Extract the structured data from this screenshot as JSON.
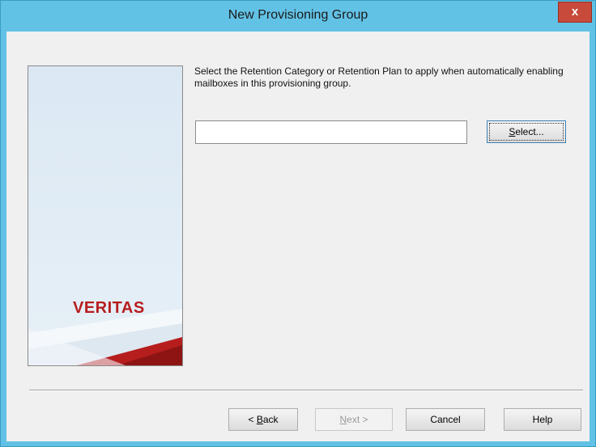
{
  "window": {
    "title": "New Provisioning Group",
    "close_label": "x"
  },
  "side_panel": {
    "logo_text": "VERITAS"
  },
  "content": {
    "instruction": "Select the Retention Category or Retention Plan to apply when automatically enabling mailboxes in this provisioning group.",
    "field_value": ""
  },
  "buttons": {
    "select": {
      "pre": "",
      "accel": "S",
      "post": "elect..."
    },
    "back": {
      "pre": "< ",
      "accel": "B",
      "post": "ack"
    },
    "next": {
      "pre": "",
      "accel": "N",
      "post": "ext >"
    },
    "cancel": "Cancel",
    "help": "Help"
  },
  "colors": {
    "title_bar": "#62c2e6",
    "close_button": "#c74a3a",
    "brand_red": "#b61e1e"
  }
}
